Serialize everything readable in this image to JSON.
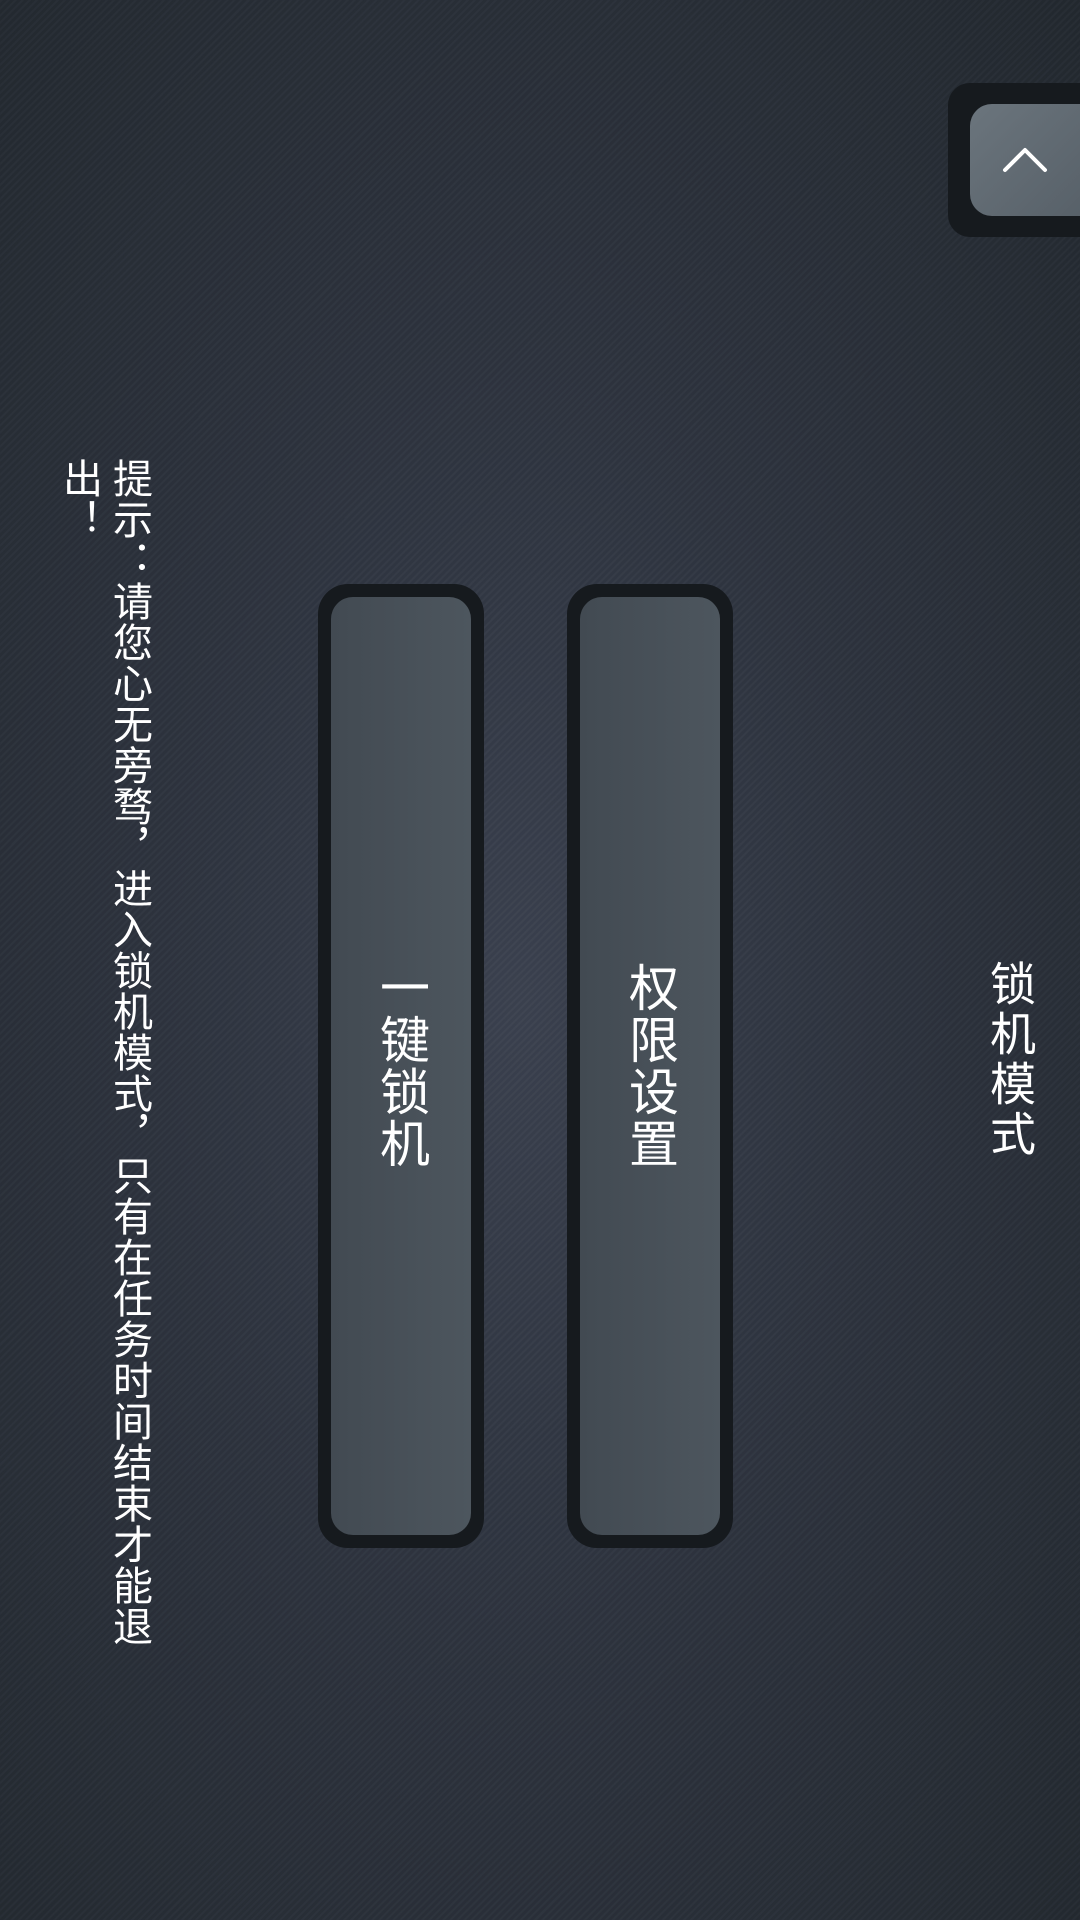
{
  "header": {
    "title": "锁机模式",
    "collapse_icon": "chevron-up-icon"
  },
  "actions": {
    "permission_settings_label": "权限设置",
    "one_click_lock_label": "一键锁机"
  },
  "hint": {
    "text": "提示：请您心无旁骛，进入锁机模式，只有在任务时间结束才能退出！"
  },
  "colors": {
    "background": "#2e343f",
    "button_fill": "#4a535b",
    "button_border": "#161a1e",
    "text": "#ffffff"
  }
}
